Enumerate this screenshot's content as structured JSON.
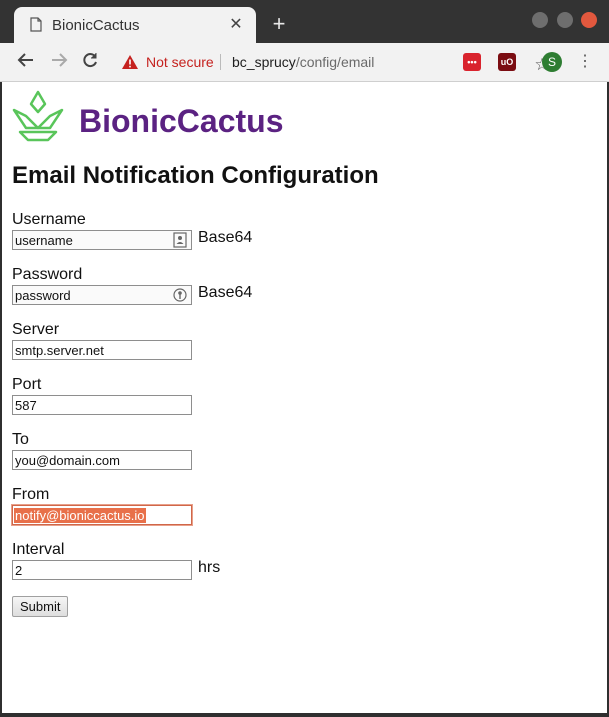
{
  "browser": {
    "tab_title": "BionicCactus",
    "new_tab_label": "+",
    "security_label": "Not secure",
    "url_host": "bc_sprucy",
    "url_path": "/config/email",
    "profile_initial": "S",
    "ext_red_label": "•••",
    "ext_ublock_label": "uO",
    "icons": {
      "favicon": "document-icon",
      "tab_close": "close-icon",
      "back": "arrow-left-icon",
      "forward": "arrow-right-icon",
      "reload": "reload-icon",
      "warning": "warning-icon",
      "bookmark": "star-icon",
      "menu": "kebab-menu-icon"
    }
  },
  "brand": {
    "name": "BionicCactus",
    "color": "#5b2282",
    "logo_color": "#59c55a"
  },
  "page": {
    "heading": "Email Notification Configuration"
  },
  "form": {
    "username": {
      "label": "Username",
      "value": "username",
      "suffix": "Base64"
    },
    "password": {
      "label": "Password",
      "value": "password",
      "suffix": "Base64"
    },
    "server": {
      "label": "Server",
      "value": "smtp.server.net"
    },
    "port": {
      "label": "Port",
      "value": "587"
    },
    "to": {
      "label": "To",
      "value": "you@domain.com"
    },
    "from": {
      "label": "From",
      "value": "notify@bioniccactus.io"
    },
    "interval": {
      "label": "Interval",
      "value": "2",
      "suffix": "hrs"
    },
    "submit_label": "Submit"
  }
}
